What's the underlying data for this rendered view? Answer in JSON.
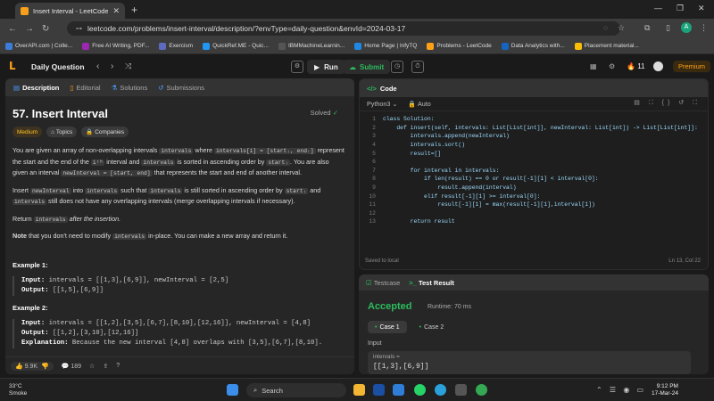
{
  "browser": {
    "tab_title": "Insert Interval - LeetCode",
    "url": "leetcode.com/problems/insert-interval/description/?envType=daily-question&envId=2024-03-17",
    "bookmarks": [
      "OverAPI.com | Colle...",
      "Free AI Writing, PDF...",
      "Exercism",
      "QuickRef.ME - Quic...",
      "IBMMachineLearnin...",
      "Home Page | InfyTQ",
      "Problems - LeetCode",
      "Data Analytics with...",
      "Placement material..."
    ],
    "bookmark_colors": [
      "#3b7dd8",
      "#9c27b0",
      "#5c6bc0",
      "#2196f3",
      "#555555",
      "#1e88e5",
      "#ffa116",
      "#1565c0",
      "#fbbc04"
    ]
  },
  "header": {
    "daily_question": "Daily Question",
    "run": "Run",
    "submit": "Submit",
    "streak": "11",
    "premium": "Premium"
  },
  "left_tabs": [
    "Description",
    "Editorial",
    "Solutions",
    "Submissions"
  ],
  "problem": {
    "title": "57. Insert Interval",
    "solved": "Solved",
    "tags": [
      "Medium",
      "Topics",
      "Companies"
    ],
    "p1a": "You are given an array of non-overlapping intervals ",
    "p1_code1": "intervals",
    "p1b": " where ",
    "p1_code2": "intervals[i] = [startᵢ, endᵢ]",
    "p1c": " represent the start and the end of the ",
    "p1_code3": "iᵗʰ",
    "p1d": " interval and ",
    "p1_code4": "intervals",
    "p1e": " is sorted in ascending order by ",
    "p1_code5": "startᵢ",
    "p1f": ". You are also given an interval ",
    "p1_code6": "newInterval = [start, end]",
    "p1g": " that represents the start and end of another interval.",
    "p2a": "Insert ",
    "p2_code1": "newInterval",
    "p2b": " into ",
    "p2_code2": "intervals",
    "p2c": " such that ",
    "p2_code3": "intervals",
    "p2d": " is still sorted in ascending order by ",
    "p2_code4": "startᵢ",
    "p2e": " and ",
    "p2_code5": "intervals",
    "p2f": " still does not have any overlapping intervals (merge overlapping intervals if necessary).",
    "p3a": "Return ",
    "p3_code": "intervals",
    "p3b": " after the insertion.",
    "p4a": "Note",
    "p4b": " that you don't need to modify ",
    "p4_code": "intervals",
    "p4c": " in-place. You can make a new array and return it.",
    "ex1_title": "Example 1:",
    "ex1_input_label": "Input:",
    "ex1_input": " intervals = [[1,3],[6,9]], newInterval = [2,5]",
    "ex1_output_label": "Output:",
    "ex1_output": " [[1,5],[6,9]]",
    "ex2_title": "Example 2:",
    "ex2_input_label": "Input:",
    "ex2_input": " intervals = [[1,2],[3,5],[6,7],[8,10],[12,16]], newInterval = [4,8]",
    "ex2_output_label": "Output:",
    "ex2_output": " [[1,2],[3,10],[12,16]]",
    "ex2_expl_label": "Explanation:",
    "ex2_expl": " Because the new interval [4,8] overlaps with [3,5],[6,7],[8,10].",
    "likes": "9.9K",
    "comments": "189"
  },
  "code_panel": {
    "title": "Code",
    "language": "Python3",
    "mode": "Auto",
    "lines": [
      "class Solution:",
      "    def insert(self, intervals: List[List[int]], newInterval: List[int]) -> List[List[int]]:",
      "        intervals.append(newInterval)",
      "        intervals.sort()",
      "        result=[]",
      "",
      "        for interval in intervals:",
      "            if len(result) == 0 or result[-1][1] < interval[0]:",
      "                result.append(interval)",
      "            elif result[-1][1] >= interval[0]:",
      "                result[-1][1] = max(result[-1][1],interval[1])",
      "",
      "        return result"
    ],
    "saved": "Saved to local",
    "cursor": "Ln 13, Col 22"
  },
  "test_panel": {
    "tabs": [
      "Testcase",
      "Test Result"
    ],
    "status": "Accepted",
    "runtime": "Runtime: 70 ms",
    "cases": [
      "Case 1",
      "Case 2"
    ],
    "input_label": "Input",
    "input_var": "intervals =",
    "input_value": "[[1,3],[6,9]]"
  },
  "taskbar": {
    "temp": "33°C",
    "weather": "Smoke",
    "search": "Search",
    "time": "9:12 PM",
    "date": "17-Mar-24"
  }
}
